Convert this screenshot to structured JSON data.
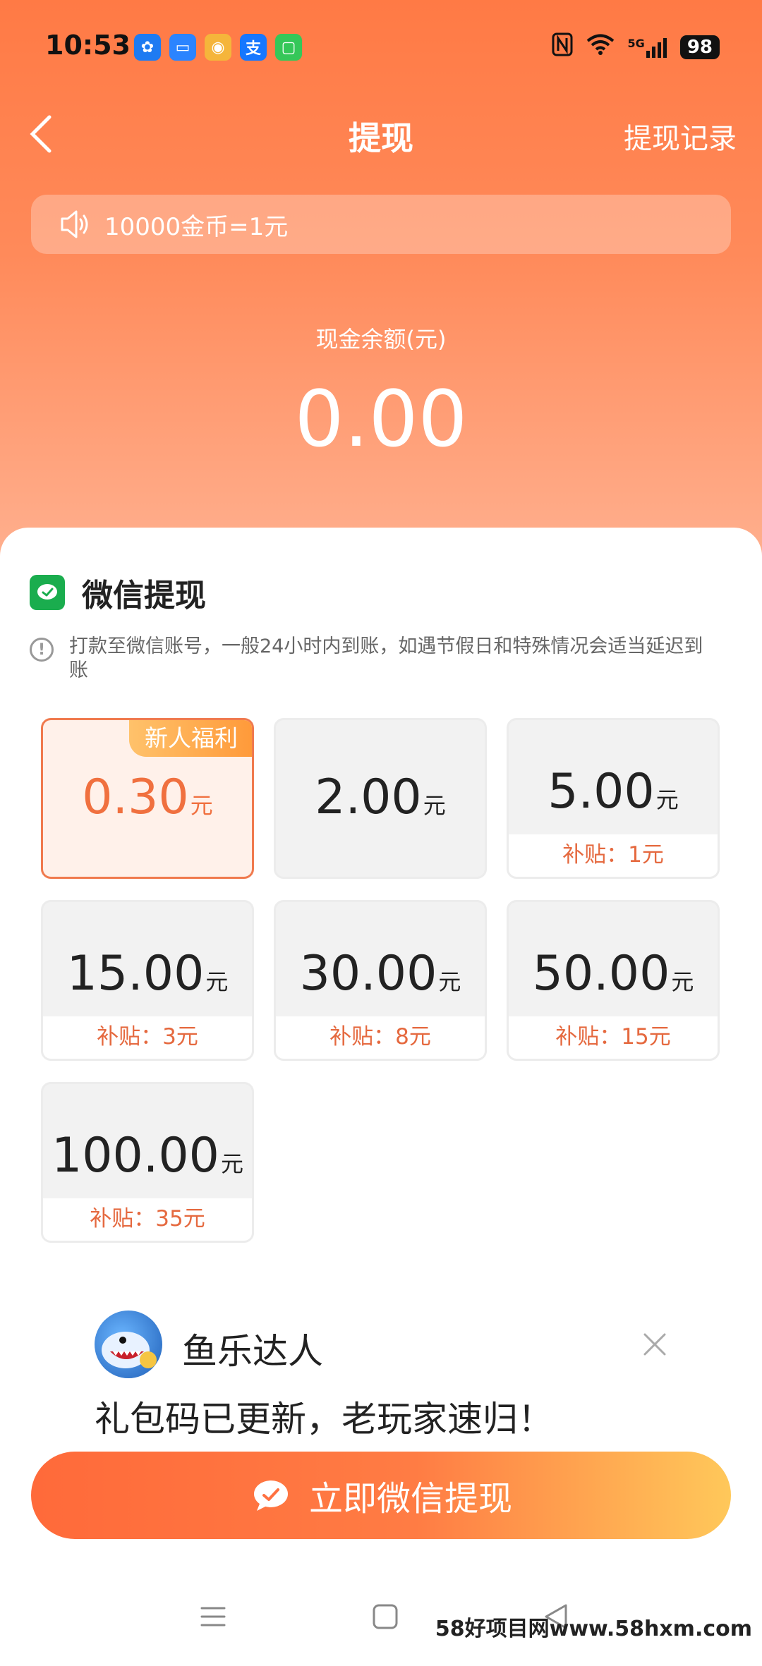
{
  "status_bar": {
    "time": "10:53",
    "app_icons": [
      {
        "name": "pinwheel-app-icon",
        "color": "#1e7bf2",
        "glyph": "✿"
      },
      {
        "name": "message-app-icon",
        "color": "#2b84ff",
        "glyph": "▭"
      },
      {
        "name": "weibo-app-icon",
        "color": "#f5b53b",
        "glyph": "◉"
      },
      {
        "name": "alipay-app-icon",
        "color": "#1677ff",
        "glyph": "支"
      },
      {
        "name": "chat-app-icon",
        "color": "#35c759",
        "glyph": "▢"
      }
    ],
    "network": "5G",
    "battery": "98"
  },
  "nav": {
    "title": "提现",
    "right_link": "提现记录"
  },
  "notice": {
    "text": "10000金币=1元"
  },
  "balance": {
    "label": "现金余额(元)",
    "value": "0.00"
  },
  "withdraw": {
    "title": "微信提现",
    "tip": "打款至微信账号，一般24小时内到账，如遇节假日和特殊情况会适当延迟到账",
    "unit": "元",
    "options": [
      {
        "amount": "0.30",
        "badge": "新人福利",
        "selected": true,
        "subsidy": ""
      },
      {
        "amount": "2.00",
        "badge": "",
        "selected": false,
        "subsidy": ""
      },
      {
        "amount": "5.00",
        "badge": "",
        "selected": false,
        "subsidy": "补贴：1元"
      },
      {
        "amount": "15.00",
        "badge": "",
        "selected": false,
        "subsidy": "补贴：3元"
      },
      {
        "amount": "30.00",
        "badge": "",
        "selected": false,
        "subsidy": "补贴：8元"
      },
      {
        "amount": "50.00",
        "badge": "",
        "selected": false,
        "subsidy": "补贴：15元"
      },
      {
        "amount": "100.00",
        "badge": "",
        "selected": false,
        "subsidy": "补贴：35元"
      }
    ]
  },
  "ad": {
    "name": "鱼乐达人",
    "text": "礼包码已更新，老玩家速归！"
  },
  "cta": {
    "label": "立即微信提现"
  },
  "watermark": "58好项目网www.58hxm.com",
  "colors": {
    "accent": "#ff7a45",
    "subsidy": "#e5693f",
    "wechat": "#1aad4e"
  }
}
